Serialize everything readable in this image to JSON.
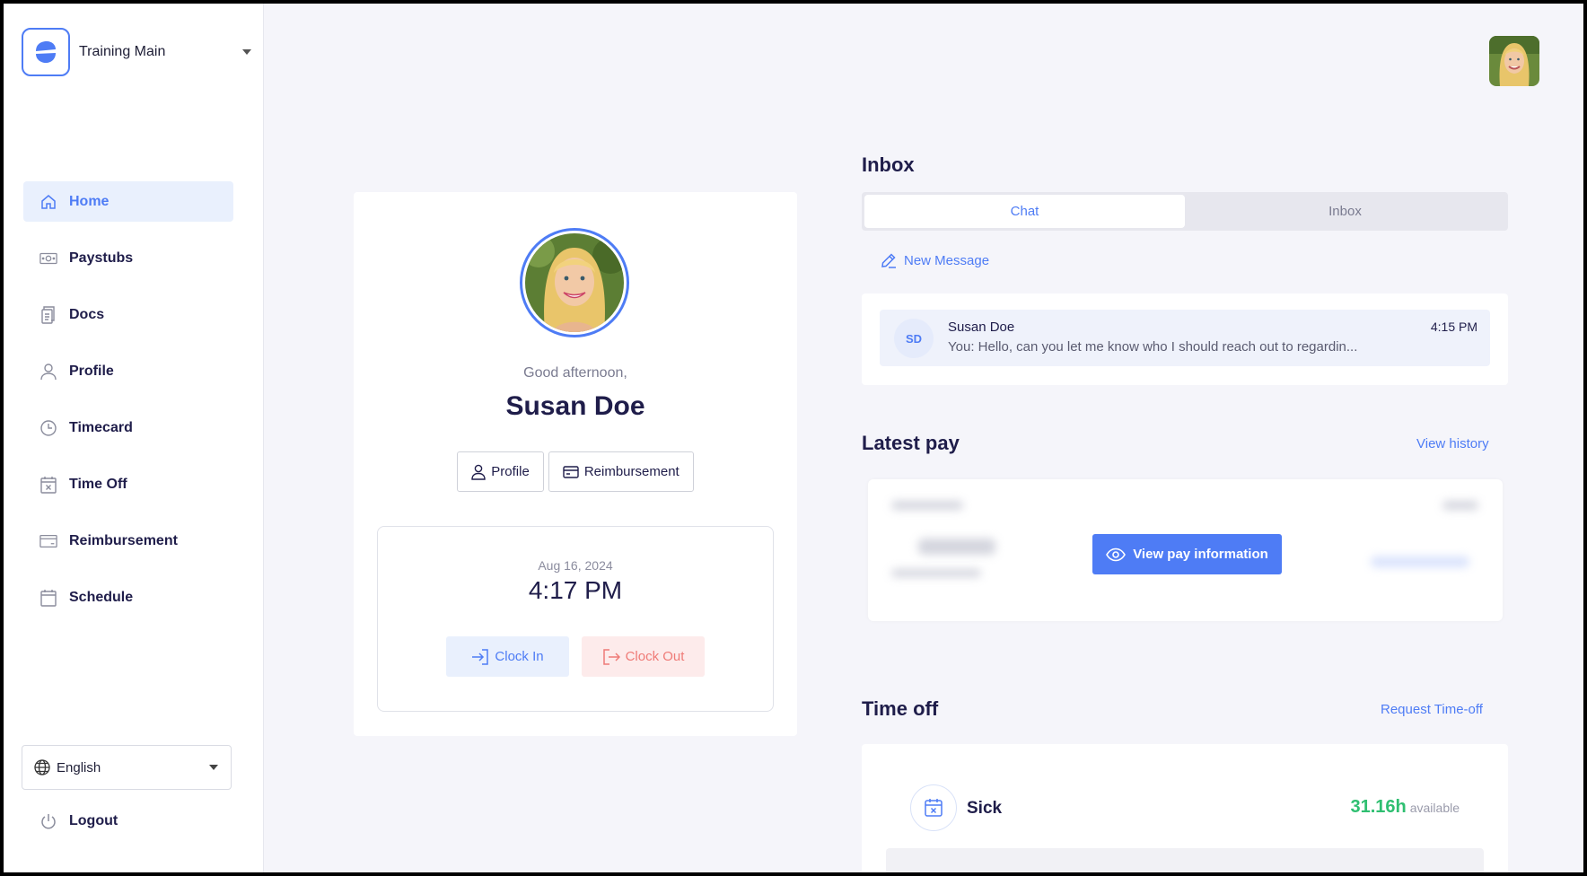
{
  "sidebar": {
    "org_name": "Training Main",
    "items": [
      {
        "label": "Home",
        "icon": "home-icon"
      },
      {
        "label": "Paystubs",
        "icon": "money-icon"
      },
      {
        "label": "Docs",
        "icon": "document-icon"
      },
      {
        "label": "Profile",
        "icon": "user-icon"
      },
      {
        "label": "Timecard",
        "icon": "clock-icon"
      },
      {
        "label": "Time Off",
        "icon": "calendar-x-icon"
      },
      {
        "label": "Reimbursement",
        "icon": "card-icon"
      },
      {
        "label": "Schedule",
        "icon": "calendar-icon"
      }
    ],
    "language": "English",
    "logout_label": "Logout"
  },
  "profile_card": {
    "greeting": "Good afternoon,",
    "name": "Susan Doe",
    "profile_button": "Profile",
    "reimbursement_button": "Reimbursement",
    "date": "Aug 16, 2024",
    "time": "4:17 PM",
    "clock_in": "Clock In",
    "clock_out": "Clock Out"
  },
  "inbox": {
    "title": "Inbox",
    "tabs": [
      {
        "label": "Chat"
      },
      {
        "label": "Inbox"
      }
    ],
    "new_message": "New Message",
    "messages": [
      {
        "initials": "SD",
        "name": "Susan Doe",
        "time": "4:15 PM",
        "preview": "You: Hello, can you let me know who I should reach out to regardin..."
      }
    ]
  },
  "latest_pay": {
    "title": "Latest pay",
    "view_history": "View history",
    "view_button": "View pay information"
  },
  "time_off": {
    "title": "Time off",
    "request_link": "Request Time-off",
    "items": [
      {
        "name": "Sick",
        "hours": "31.16h",
        "unit": "available"
      }
    ]
  },
  "colors": {
    "accent": "#4e7cf5",
    "success": "#2fbf71",
    "danger": "#ef7b77"
  }
}
